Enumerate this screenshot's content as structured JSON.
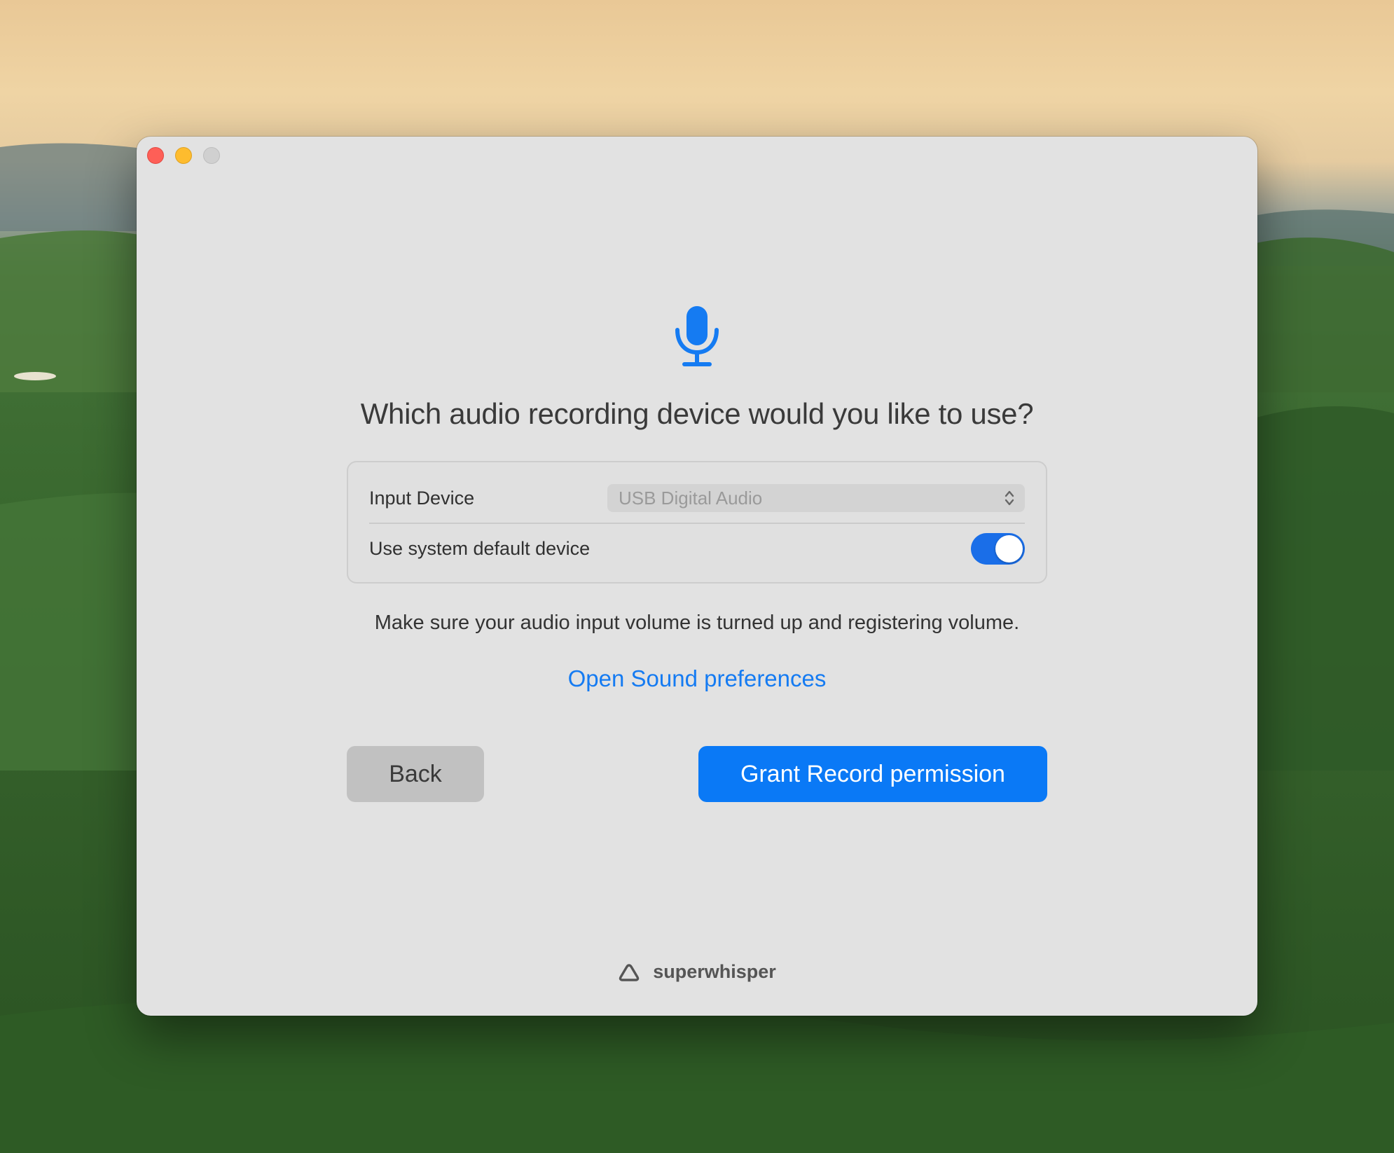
{
  "window": {
    "controls": [
      "close",
      "minimize",
      "zoom"
    ]
  },
  "main": {
    "icon": "microphone-icon",
    "title": "Which audio recording device would you like to use?",
    "input_device_label": "Input Device",
    "input_device_value": "USB Digital Audio",
    "system_default_label": "Use system default device",
    "system_default_enabled": true,
    "hint": "Make sure your audio input volume is turned up and registering volume.",
    "link": "Open Sound preferences"
  },
  "buttons": {
    "back": "Back",
    "grant": "Grant Record permission"
  },
  "footer": {
    "logo_icon": "superwhisper-logo-icon",
    "brand": "superwhisper"
  },
  "colors": {
    "accent": "#0a79f6",
    "link": "#157bf2",
    "toggle_on": "#1a6ee8"
  }
}
